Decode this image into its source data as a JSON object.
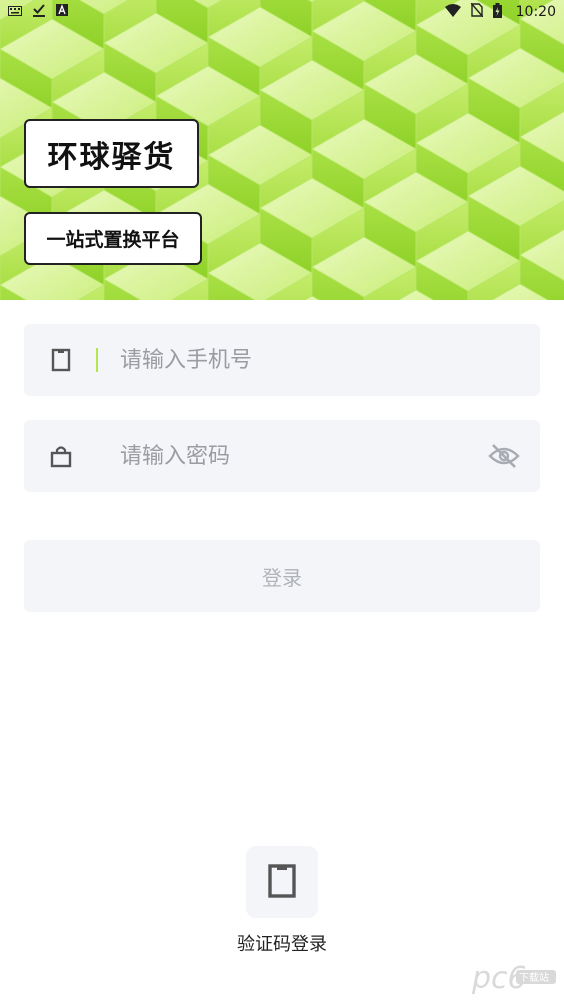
{
  "status_bar": {
    "time": "10:20",
    "icons_left": [
      "keyboard-icon",
      "download-check-icon",
      "a-badge-icon"
    ],
    "icons_right": [
      "wifi-icon",
      "no-sim-icon",
      "battery-charging-icon"
    ]
  },
  "hero": {
    "title": "环球驿货",
    "subtitle": "一站式置换平台",
    "accent_color": "#a3dc3a"
  },
  "form": {
    "phone": {
      "placeholder": "请输入手机号",
      "value": "",
      "icon": "phone-icon"
    },
    "password": {
      "placeholder": "请输入密码",
      "value": "",
      "icon": "lock-icon",
      "toggle_icon": "eye-off-icon"
    },
    "login_label": "登录"
  },
  "alt_login": {
    "label": "验证码登录",
    "icon": "phone-icon"
  },
  "watermark": {
    "logo_text": "pc6",
    "sub_text": "下载站"
  }
}
